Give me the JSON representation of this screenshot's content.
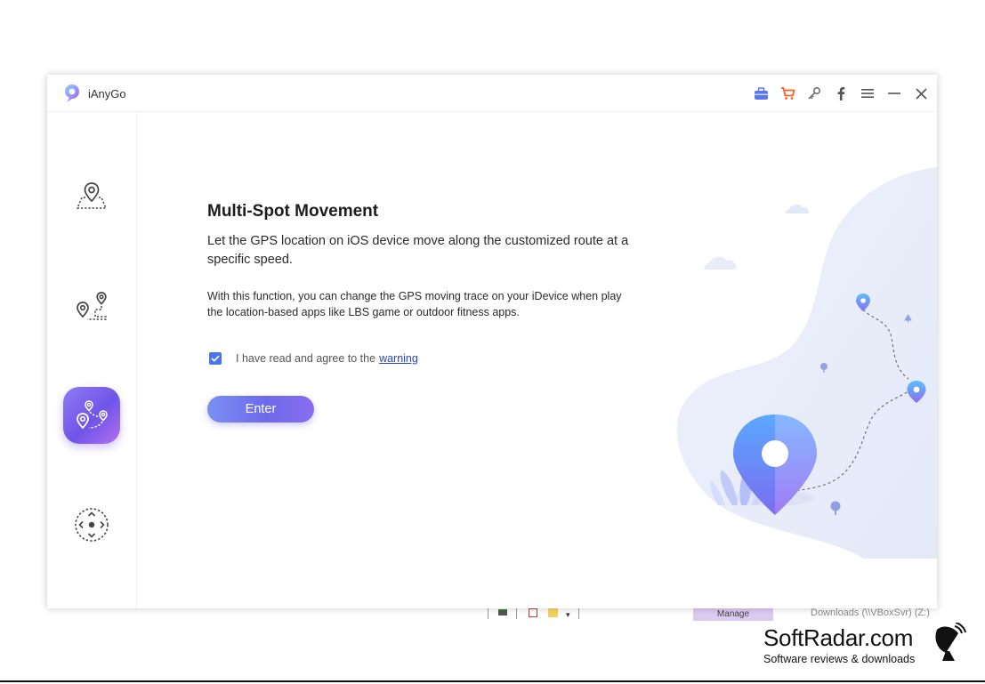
{
  "app": {
    "name": "iAnyGo"
  },
  "titlebar": {
    "icons": [
      "toolbox-icon",
      "cart-icon",
      "key-icon",
      "facebook-icon",
      "menu-icon",
      "minimize-icon",
      "close-icon"
    ]
  },
  "sidebar": {
    "items": [
      {
        "icon": "location-map-pin-icon",
        "active": false
      },
      {
        "icon": "two-spot-route-icon",
        "active": false
      },
      {
        "icon": "multi-spot-route-icon",
        "active": true
      },
      {
        "icon": "joystick-icon",
        "active": false
      }
    ]
  },
  "main": {
    "title": "Multi-Spot Movement",
    "subtitle": "Let the GPS location on iOS device move along the customized route at a specific speed.",
    "description": "With this function, you can change the GPS moving trace on your iDevice when play the location-based apps like LBS game or outdoor fitness apps.",
    "agree_text": "I have read and agree to the",
    "agree_link": "warning",
    "agree_checked": true,
    "enter_label": "Enter"
  },
  "background_os": {
    "manage_label": "Manage",
    "downloads_label": "Downloads (\\\\VBoxSvr) (Z:)"
  },
  "watermark": {
    "title": "SoftRadar.com",
    "subtitle": "Software reviews & downloads"
  },
  "colors": {
    "accent": "#6f55e8",
    "checkbox": "#4a74ec",
    "link": "#2a44c6",
    "cart": "#f0622a"
  }
}
